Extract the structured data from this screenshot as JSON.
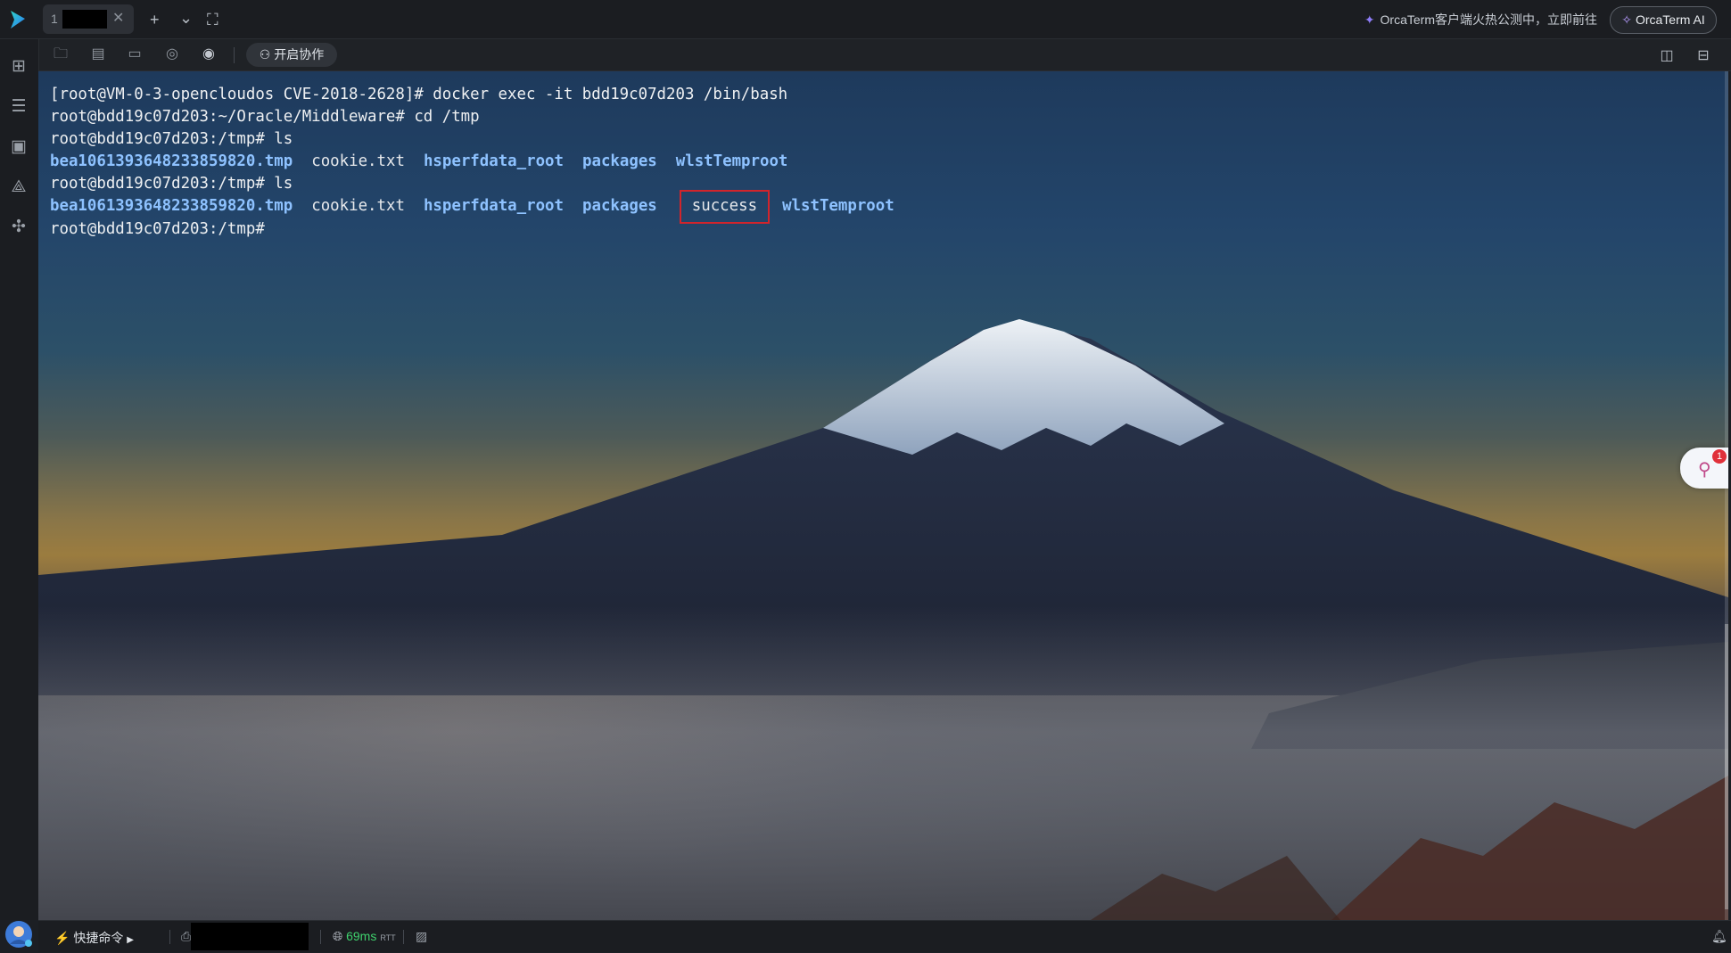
{
  "window": {
    "tab": {
      "index": "1",
      "title": "",
      "close_glyph": "✕"
    },
    "new_tab_glyph": "+",
    "dropdown_glyph": "⌄",
    "fullscreen_glyph": "⛶",
    "promo_text": "OrcaTerm客户端火热公测中，立即前往",
    "ai_button_label": "OrcaTerm AI"
  },
  "toolbar": {
    "collab_label": "开启协作"
  },
  "terminal": {
    "lines": [
      "[root@VM-0-3-opencloudos CVE-2018-2628]# docker exec -it bdd19c07d203 /bin/bash",
      "root@bdd19c07d203:~/Oracle/Middleware# cd /tmp",
      "root@bdd19c07d203:/tmp# ls"
    ],
    "ls1": [
      "bea1061393648233859820.tmp",
      "cookie.txt",
      "hsperfdata_root",
      "packages",
      "wlstTemproot"
    ],
    "prompt_ls2": "root@bdd19c07d203:/tmp# ls",
    "ls2": [
      "bea1061393648233859820.tmp",
      "cookie.txt",
      "hsperfdata_root",
      "packages",
      "success",
      "wlstTemproot"
    ],
    "final_prompt": "root@bdd19c07d203:/tmp#",
    "highlight_color": "#d2242b",
    "dir_color": "#8ec2ff"
  },
  "assistant": {
    "badge_count": "1"
  },
  "statusbar": {
    "quick_cmd_label": "快捷命令",
    "host": "",
    "latency": "69ms",
    "latency_unit": "RTT"
  }
}
